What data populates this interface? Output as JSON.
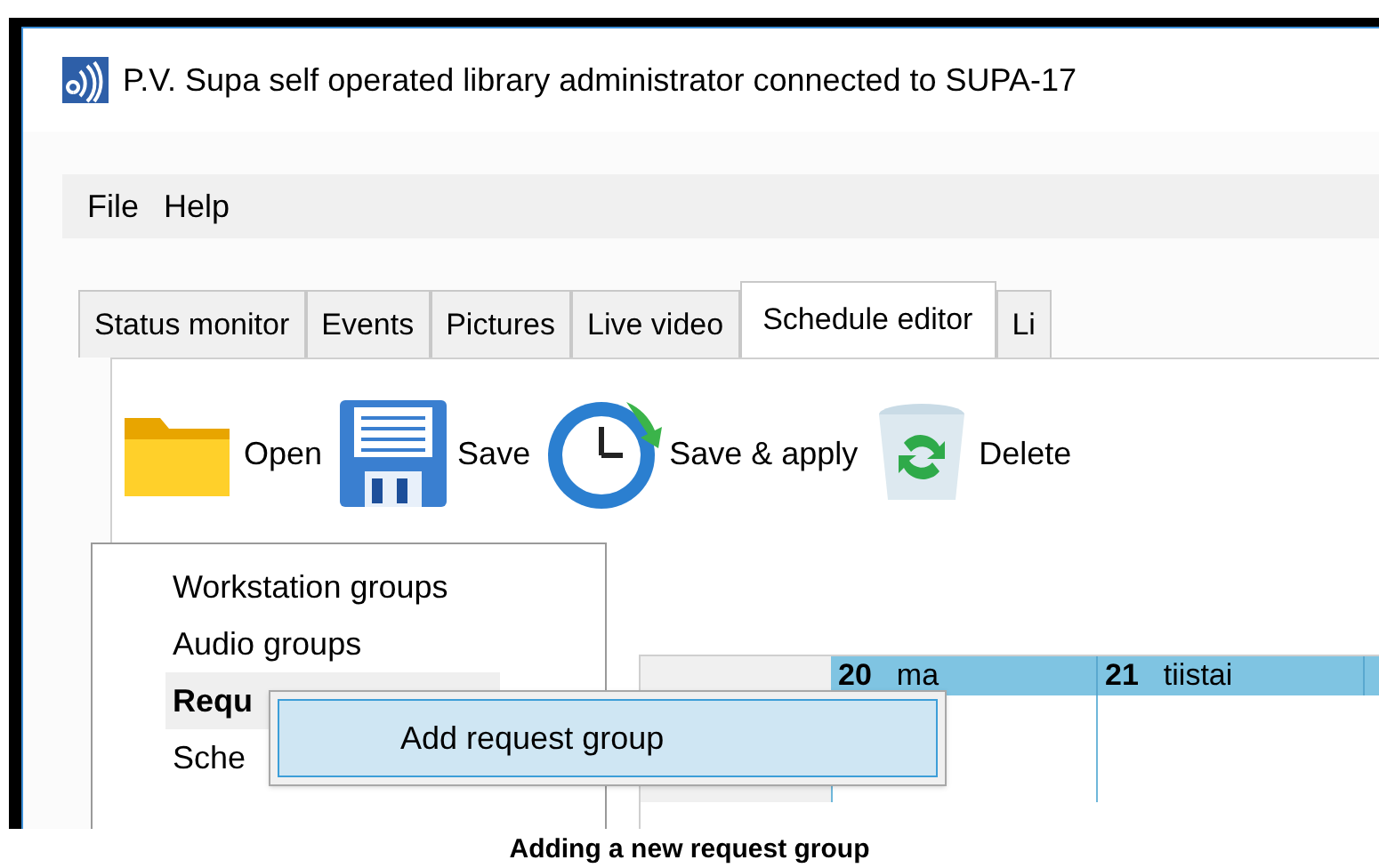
{
  "window": {
    "title": "P.V. Supa self operated library administrator connected to SUPA-17"
  },
  "menu": [
    "File",
    "Help"
  ],
  "tabs": [
    {
      "label": "Status monitor",
      "selected": false
    },
    {
      "label": "Events",
      "selected": false
    },
    {
      "label": "Pictures",
      "selected": false
    },
    {
      "label": "Live video",
      "selected": false
    },
    {
      "label": "Schedule editor",
      "selected": true
    },
    {
      "label": "Li",
      "selected": false
    }
  ],
  "toolbar": [
    {
      "label": "Open",
      "kind": "folder"
    },
    {
      "label": "Save",
      "kind": "floppy"
    },
    {
      "label": "Save & apply",
      "kind": "clock"
    },
    {
      "label": "Delete",
      "kind": "bin"
    }
  ],
  "tree": {
    "items": [
      {
        "label": "Workstation groups",
        "selected": false
      },
      {
        "label": "Audio groups",
        "selected": false
      },
      {
        "label": "Requ",
        "selected": true
      },
      {
        "label": "Sche",
        "selected": false
      }
    ]
  },
  "grid": {
    "days": [
      {
        "day": "20",
        "weekday": "ma"
      },
      {
        "day": "21",
        "weekday": "tiistai"
      }
    ]
  },
  "context_menu": {
    "items": [
      {
        "label": "Add request group",
        "selected": true
      }
    ]
  },
  "caption": "Adding a new request group"
}
